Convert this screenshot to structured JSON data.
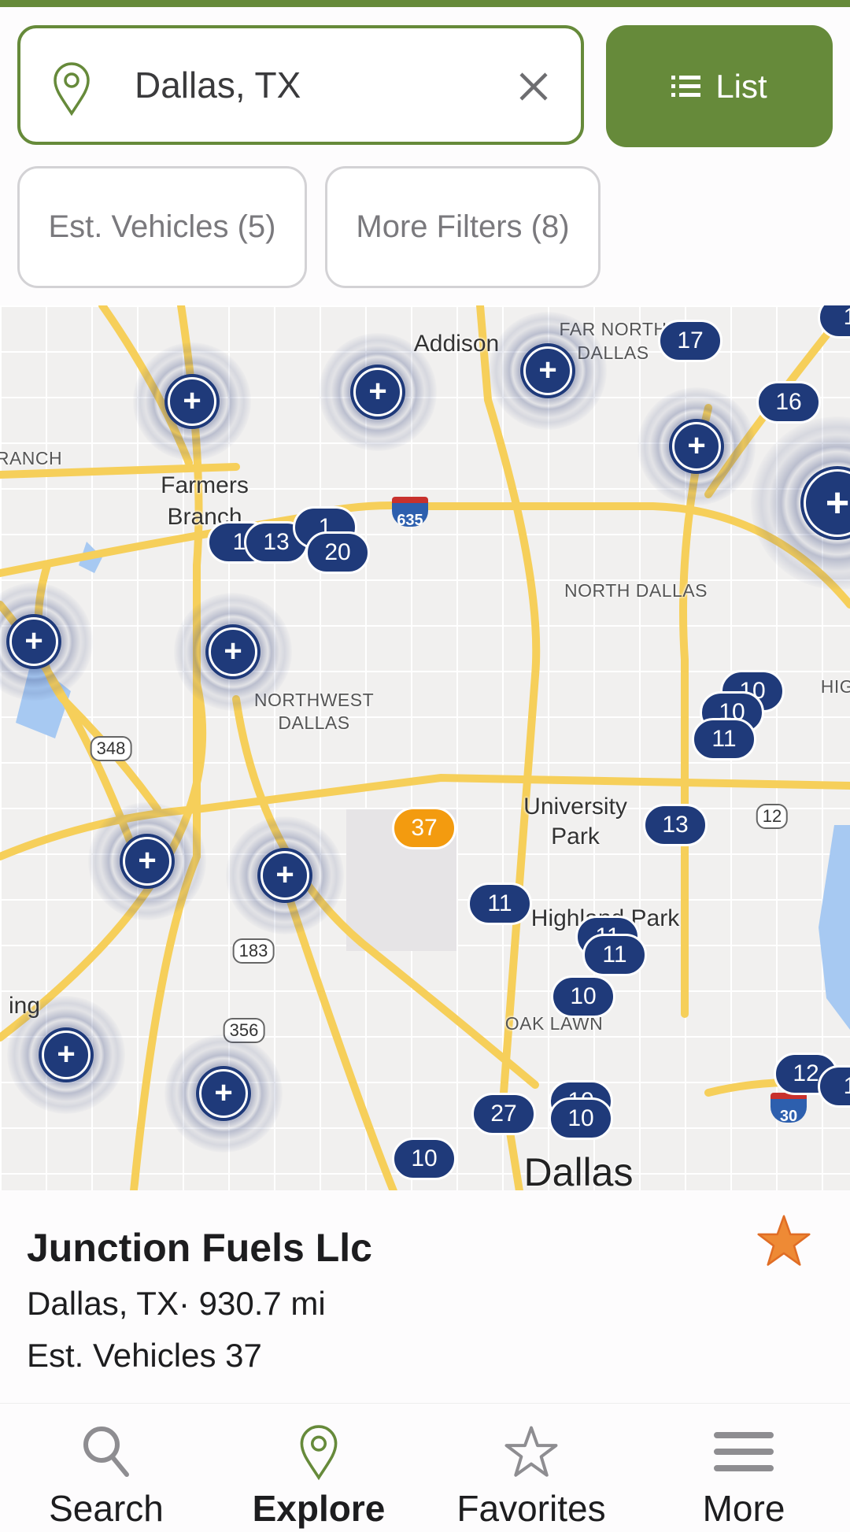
{
  "search": {
    "value": "Dallas, TX",
    "icon": "map-pin-icon",
    "clear_icon": "close-icon"
  },
  "list_button": {
    "label": "List",
    "icon": "list-icon"
  },
  "filters": [
    {
      "label": "Est. Vehicles (5)"
    },
    {
      "label": "More Filters (8)"
    }
  ],
  "map": {
    "labels": [
      "Addison",
      "FAR NORTH",
      "DALLAS",
      "RANCH",
      "Farmers",
      "Branch",
      "NORTH DALLAS",
      "NORTHWEST",
      "DALLAS",
      "University",
      "Park",
      "Highland Park",
      "OAK LAWN",
      "Dallas",
      "ing",
      "HIG"
    ],
    "shields": [
      "635",
      "348",
      "183",
      "356",
      "12",
      "30"
    ],
    "cluster_icon": "plus",
    "markers": [
      "17",
      "16",
      "1",
      "1",
      "13",
      "1",
      "20",
      "10",
      "10",
      "11",
      "13",
      "11",
      "11",
      "11",
      "10",
      "27",
      "10",
      "10",
      "10",
      "12",
      "1",
      "37"
    ],
    "selected_color": "#f39b0f",
    "marker_color": "#1f3a7a"
  },
  "info": {
    "title": "Junction Fuels Llc",
    "location": "Dallas, TX· 930.7 mi",
    "vehicles": "Est. Vehicles 37",
    "favorite": true,
    "star_color": "#ee8a35"
  },
  "nav": [
    {
      "label": "Search",
      "icon": "search-icon"
    },
    {
      "label": "Explore",
      "icon": "map-pin-icon",
      "active": true
    },
    {
      "label": "Favorites",
      "icon": "star-icon"
    },
    {
      "label": "More",
      "icon": "menu-icon"
    }
  ],
  "accent": "#668a3a"
}
